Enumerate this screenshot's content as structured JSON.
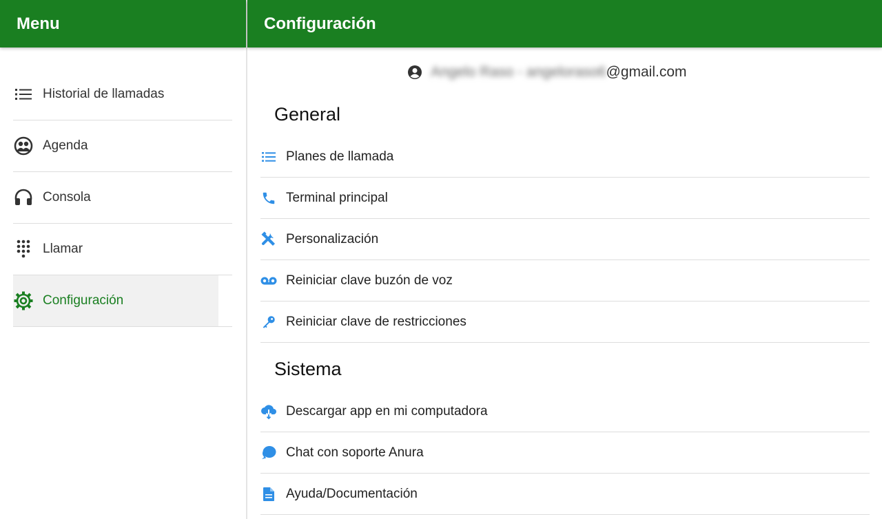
{
  "sidebar": {
    "title": "Menu",
    "items": [
      {
        "label": "Historial de llamadas",
        "icon": "list-icon"
      },
      {
        "label": "Agenda",
        "icon": "contacts-icon"
      },
      {
        "label": "Consola",
        "icon": "headset-icon"
      },
      {
        "label": "Llamar",
        "icon": "dialpad-icon"
      },
      {
        "label": "Configuración",
        "icon": "gear-icon",
        "active": true
      }
    ]
  },
  "header": {
    "title": "Configuración"
  },
  "account": {
    "name_blurred": "Angelo Raso - angeloraso6",
    "email_suffix": "@gmail.com",
    "icon": "account-circle-icon"
  },
  "sections": {
    "general": {
      "title": "General",
      "items": [
        {
          "label": "Planes de llamada",
          "icon": "list-icon"
        },
        {
          "label": "Terminal principal",
          "icon": "phone-icon"
        },
        {
          "label": "Personalización",
          "icon": "tools-icon"
        },
        {
          "label": "Reiniciar clave buzón de voz",
          "icon": "voicemail-icon"
        },
        {
          "label": "Reiniciar clave de restricciones",
          "icon": "key-icon"
        }
      ]
    },
    "sistema": {
      "title": "Sistema",
      "items": [
        {
          "label": "Descargar app en mi computadora",
          "icon": "cloud-download-icon"
        },
        {
          "label": "Chat con soporte Anura",
          "icon": "chat-icon"
        },
        {
          "label": "Ayuda/Documentación",
          "icon": "document-icon"
        }
      ]
    }
  },
  "colors": {
    "brand_green": "#1a7f21",
    "icon_blue": "#2f8fe6",
    "icon_dark": "#333333"
  }
}
